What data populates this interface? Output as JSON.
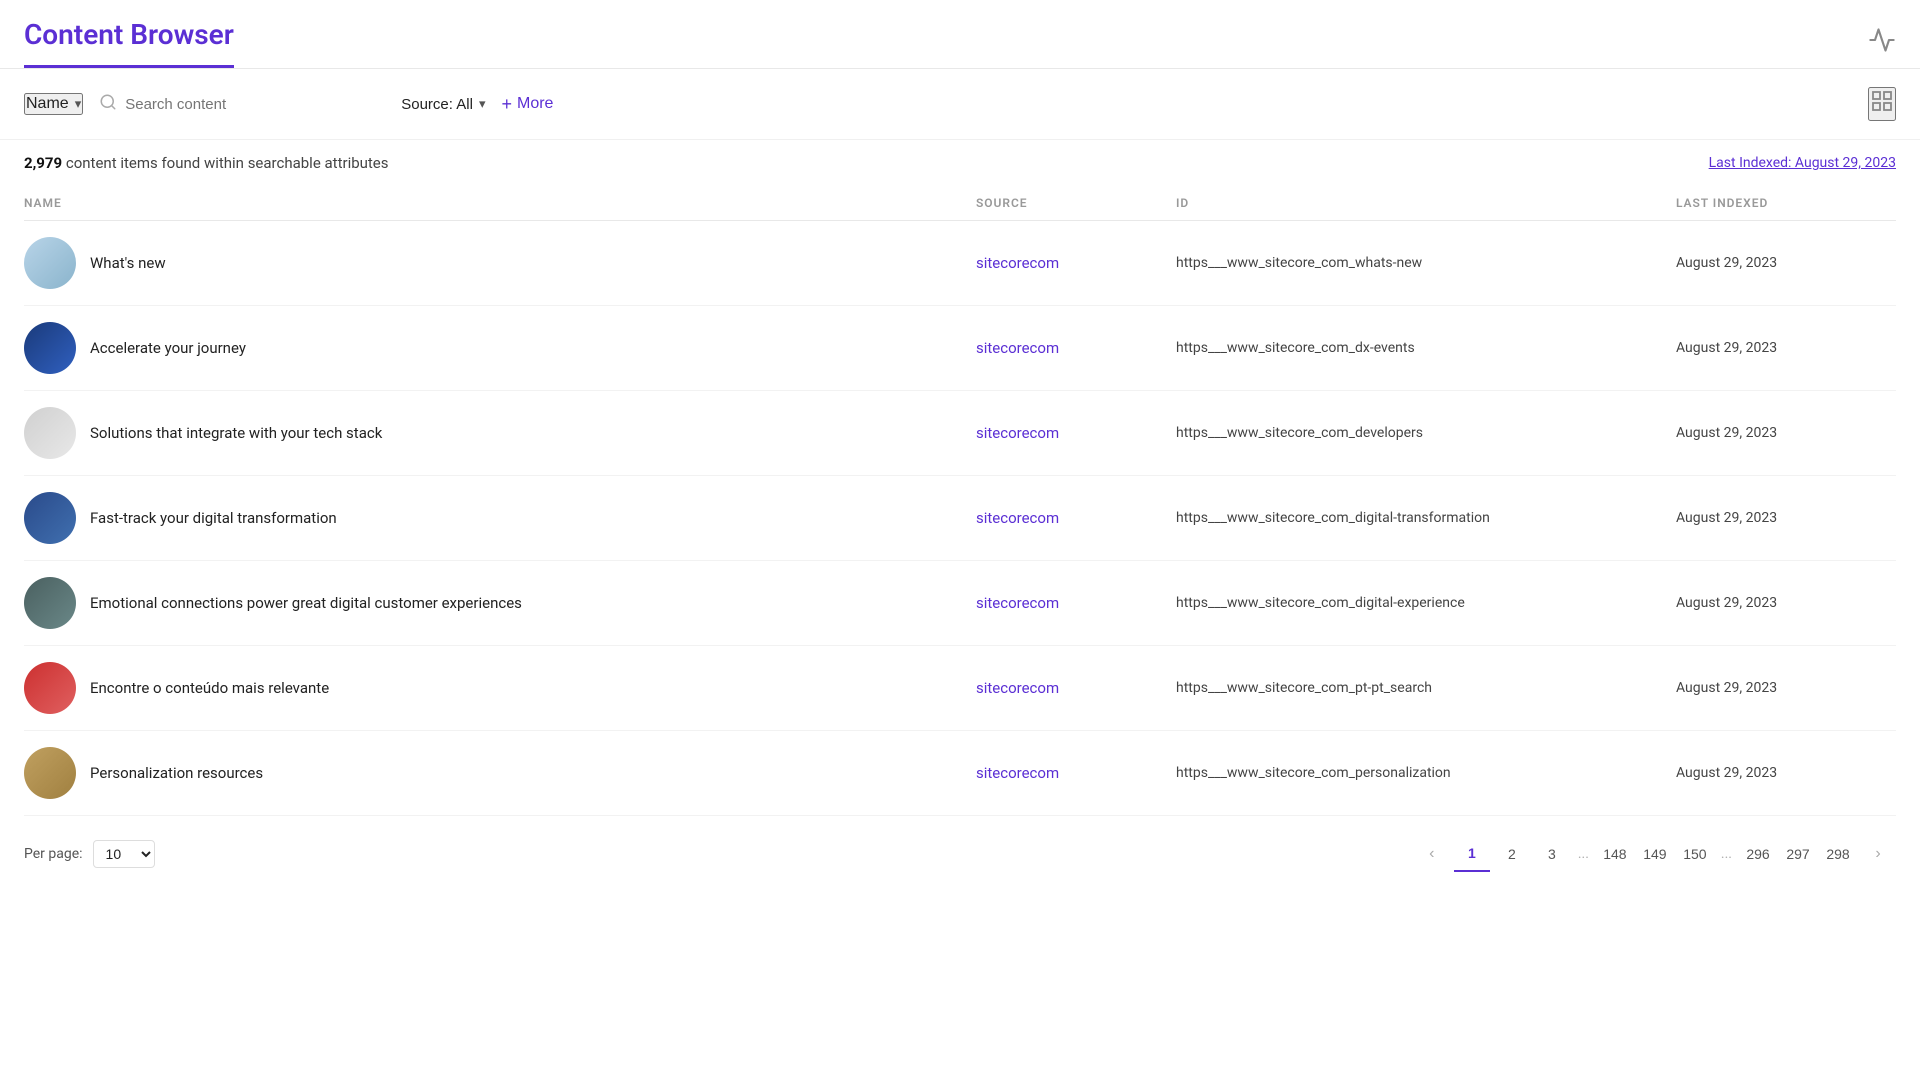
{
  "header": {
    "title": "Content Browser",
    "icon": "📈"
  },
  "toolbar": {
    "name_label": "Name",
    "search_placeholder": "Search content",
    "source_label": "Source: All",
    "more_label": "More",
    "grid_icon": "⊞"
  },
  "stats": {
    "count": "2,979",
    "description": "content items found within searchable attributes",
    "last_indexed_label": "Last Indexed: August 29, 2023"
  },
  "columns": {
    "name": "NAME",
    "source": "SOURCE",
    "id": "ID",
    "last_indexed": "LAST INDEXED"
  },
  "rows": [
    {
      "name": "What's new",
      "source": "sitecorecom",
      "id": "https___www_sitecore_com_whats-new",
      "date": "August 29, 2023",
      "avatar_class": "av-1"
    },
    {
      "name": "Accelerate your journey",
      "source": "sitecorecom",
      "id": "https___www_sitecore_com_dx-events",
      "date": "August 29, 2023",
      "avatar_class": "av-2"
    },
    {
      "name": "Solutions that integrate with your tech stack",
      "source": "sitecorecom",
      "id": "https___www_sitecore_com_developers",
      "date": "August 29, 2023",
      "avatar_class": "av-3"
    },
    {
      "name": "Fast-track your digital transformation",
      "source": "sitecorecom",
      "id": "https___www_sitecore_com_digital-transformation",
      "date": "August 29, 2023",
      "avatar_class": "av-4"
    },
    {
      "name": "Emotional connections power great digital customer experiences",
      "source": "sitecorecom",
      "id": "https___www_sitecore_com_digital-experience",
      "date": "August 29, 2023",
      "avatar_class": "av-5"
    },
    {
      "name": "Encontre o conteúdo mais relevante",
      "source": "sitecorecom",
      "id": "https___www_sitecore_com_pt-pt_search",
      "date": "August 29, 2023",
      "avatar_class": "av-7"
    },
    {
      "name": "Personalization resources",
      "source": "sitecorecom",
      "id": "https___www_sitecore_com_personalization",
      "date": "August 29, 2023",
      "avatar_class": "av-8"
    }
  ],
  "pagination": {
    "per_page_label": "Per page:",
    "per_page_value": "10",
    "pages": [
      "1",
      "2",
      "3",
      "...",
      "148",
      "149",
      "150",
      "...",
      "296",
      "297",
      "298"
    ],
    "active_page": "1"
  }
}
